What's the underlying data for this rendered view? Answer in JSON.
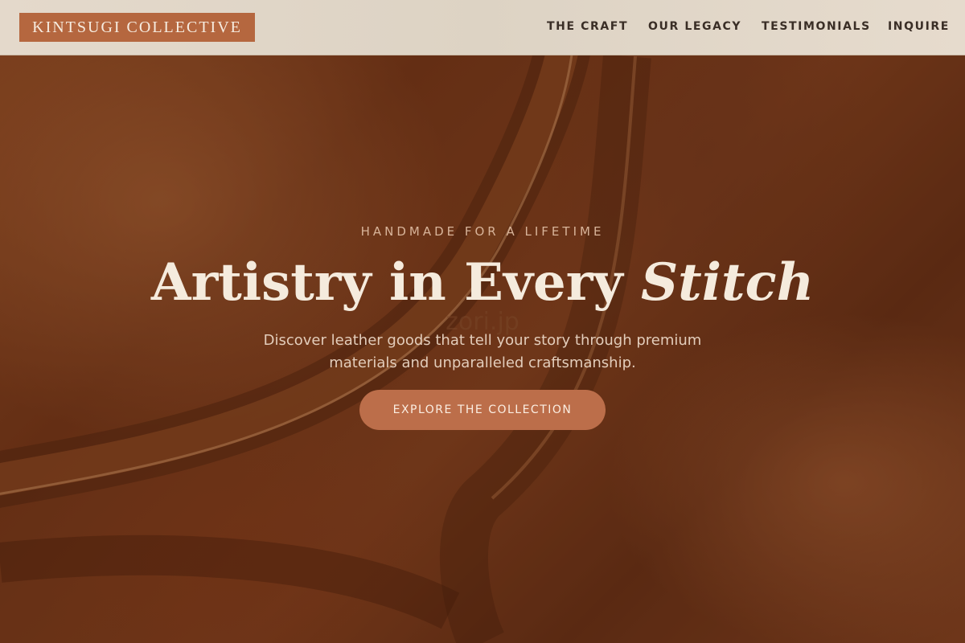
{
  "header": {
    "logo_text": "KINTSUGI COLLECTIVE",
    "nav": [
      {
        "label": "THE CRAFT"
      },
      {
        "label": "OUR LEGACY"
      },
      {
        "label": "TESTIMONIALS"
      },
      {
        "label": "INQUIRE"
      }
    ]
  },
  "hero": {
    "eyebrow": "HANDMADE FOR A LIFETIME",
    "headline_main": "Artistry in Every ",
    "headline_emphasis": "Stitch",
    "watermark": "zori.jp",
    "subtitle": "Discover leather goods that tell your story through premium materials and unparalleled craftsmanship.",
    "cta_label": "EXPLORE THE COLLECTION",
    "background_image": "leather-bag-closeup"
  },
  "colors": {
    "accent": "#b5673f",
    "cta": "#bc6e4a",
    "header_bg": "#e4d9cb",
    "nav_text": "#3a2e26",
    "headline": "#f5ebdd"
  }
}
